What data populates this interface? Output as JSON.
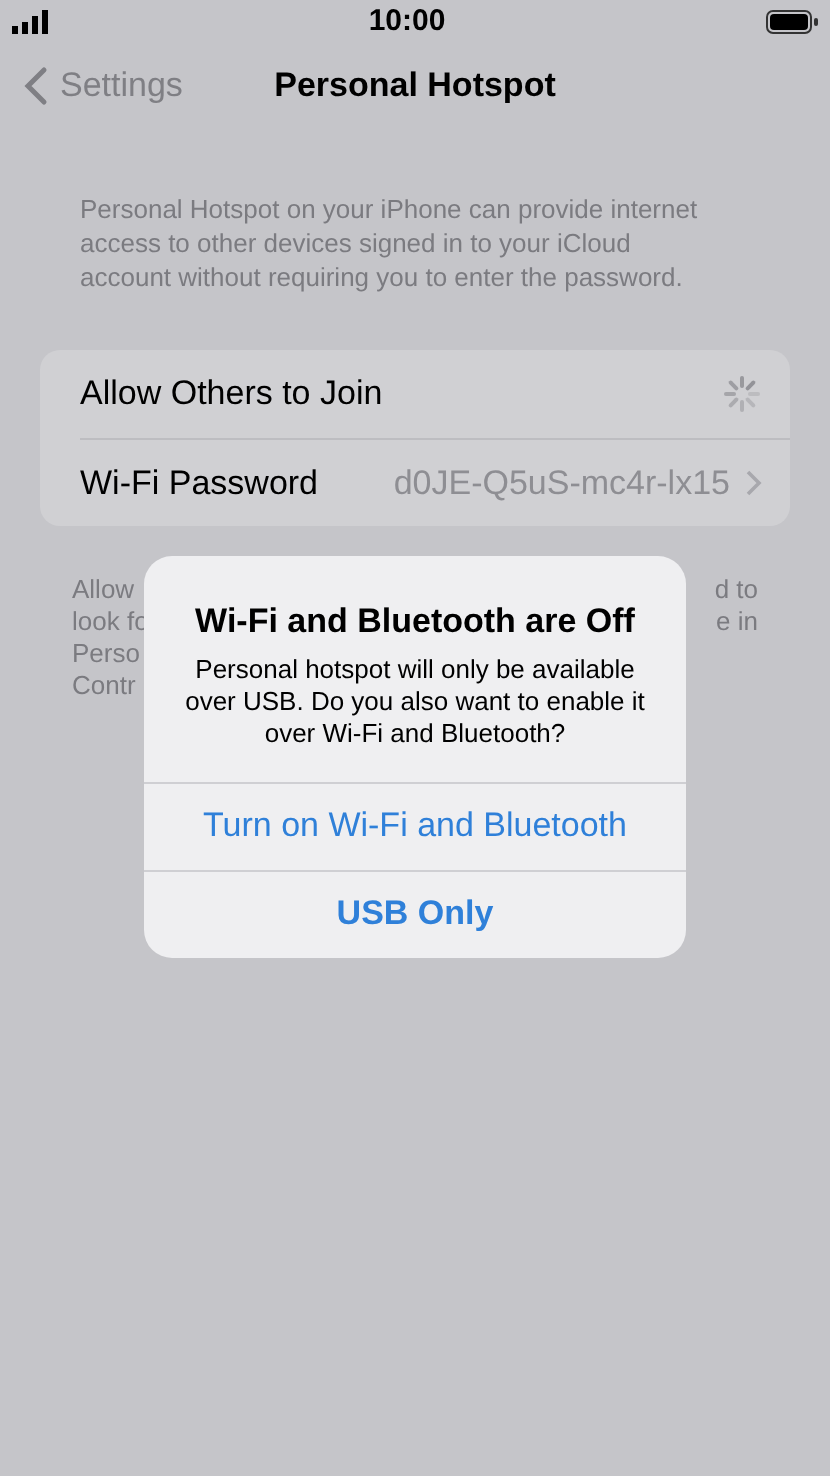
{
  "status_bar": {
    "time": "10:00"
  },
  "nav": {
    "back": "Settings",
    "title": "Personal Hotspot"
  },
  "description": "Personal Hotspot on your iPhone can provide internet access to other devices signed in to your iCloud account without requiring you to enter the password.",
  "rows": [
    {
      "kind": "loading",
      "label": "Allow Others to Join"
    },
    {
      "kind": "link",
      "label": "Wi-Fi Password",
      "value": "d0JE-Q5uS-mc4r-lx15"
    }
  ],
  "footer_lines": [
    {
      "left": "Allow",
      "right": "d to"
    },
    {
      "left": "look fo",
      "right": "e in"
    },
    {
      "left": "Perso"
    },
    {
      "left": "Contr"
    }
  ],
  "alert": {
    "title": "Wi-Fi and Bluetooth are Off",
    "message": "Personal hotspot will only be available over USB. Do you also want to enable it over Wi-Fi and Bluetooth?",
    "buttons": [
      {
        "label": "Turn on Wi-Fi and Bluetooth",
        "bold": false
      },
      {
        "label": "USB Only",
        "bold": true
      }
    ]
  }
}
